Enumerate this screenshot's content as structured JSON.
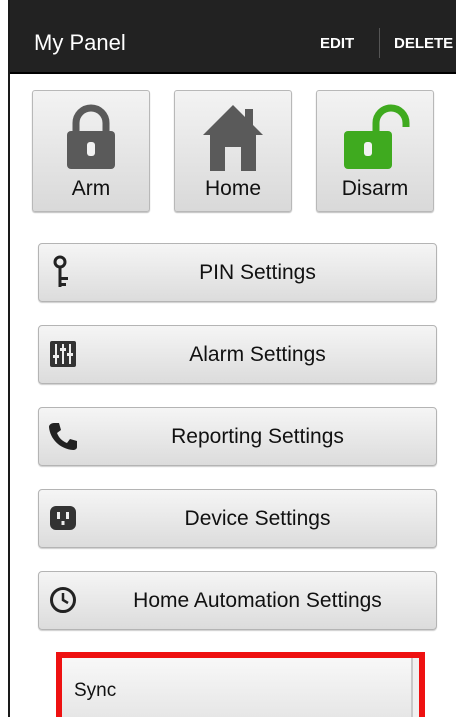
{
  "actionbar": {
    "title": "My Panel",
    "edit_label": "EDIT",
    "delete_label": "DELETE"
  },
  "modes": [
    {
      "label": "Arm",
      "icon": "lock-closed-icon",
      "color": "#5a5a5a"
    },
    {
      "label": "Home",
      "icon": "house-icon",
      "color": "#5a5a5a"
    },
    {
      "label": "Disarm",
      "icon": "lock-open-icon",
      "color": "#3faa1f"
    }
  ],
  "settings": [
    {
      "label": "PIN Settings",
      "icon": "key-icon"
    },
    {
      "label": "Alarm Settings",
      "icon": "sliders-icon"
    },
    {
      "label": "Reporting Settings",
      "icon": "phone-icon"
    },
    {
      "label": "Device Settings",
      "icon": "outlet-icon"
    },
    {
      "label": "Home Automation Settings",
      "icon": "clock-icon"
    }
  ],
  "sync": {
    "label": "Sync",
    "highlight_color": "#ee1111"
  }
}
